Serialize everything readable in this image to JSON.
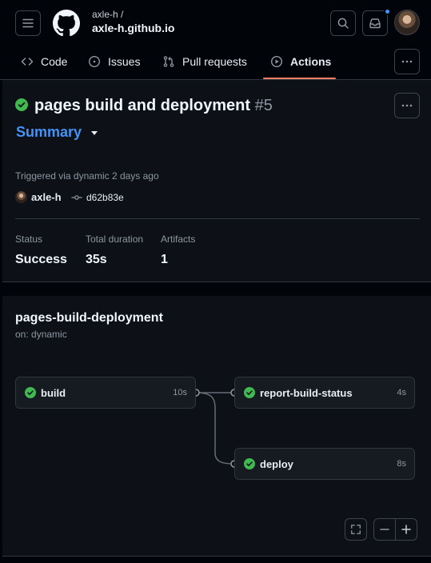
{
  "header": {
    "repo_owner": "axle-h /",
    "repo_name": "axle-h.github.io",
    "icons": [
      "hamburger-menu-icon",
      "github-logo-icon",
      "search-icon",
      "inbox-icon",
      "user-avatar"
    ]
  },
  "tabs": [
    {
      "label": "Code",
      "icon": "code-icon"
    },
    {
      "label": "Issues",
      "icon": "issue-opened-icon"
    },
    {
      "label": "Pull requests",
      "icon": "git-pull-request-icon"
    },
    {
      "label": "Actions",
      "icon": "play-icon",
      "selected": true
    }
  ],
  "run": {
    "title": "pages build and deployment",
    "number": "#5",
    "status_icon": "check-circle-icon",
    "summary_tab": "Summary",
    "triggered": "Triggered via dynamic 2 days ago",
    "actor": "axle-h",
    "commit": "d62b83e",
    "stats": [
      {
        "label": "Status",
        "value": "Success"
      },
      {
        "label": "Total duration",
        "value": "35s"
      },
      {
        "label": "Artifacts",
        "value": "1"
      }
    ]
  },
  "workflow": {
    "name": "pages-build-deployment",
    "trigger": "on: dynamic",
    "jobs": [
      {
        "name": "build",
        "duration": "10s",
        "status": "success"
      },
      {
        "name": "report-build-status",
        "duration": "4s",
        "status": "success"
      },
      {
        "name": "deploy",
        "duration": "8s",
        "status": "success"
      }
    ],
    "zoom_controls": [
      "fullscreen-icon",
      "zoom-out-icon",
      "zoom-in-icon"
    ]
  },
  "colors": {
    "background": "#010409",
    "panel": "#0d1117",
    "success": "#3fb950",
    "accent_link": "#4493f8",
    "tab_underline": "#f78166",
    "notification_dot": "#4493f8"
  }
}
